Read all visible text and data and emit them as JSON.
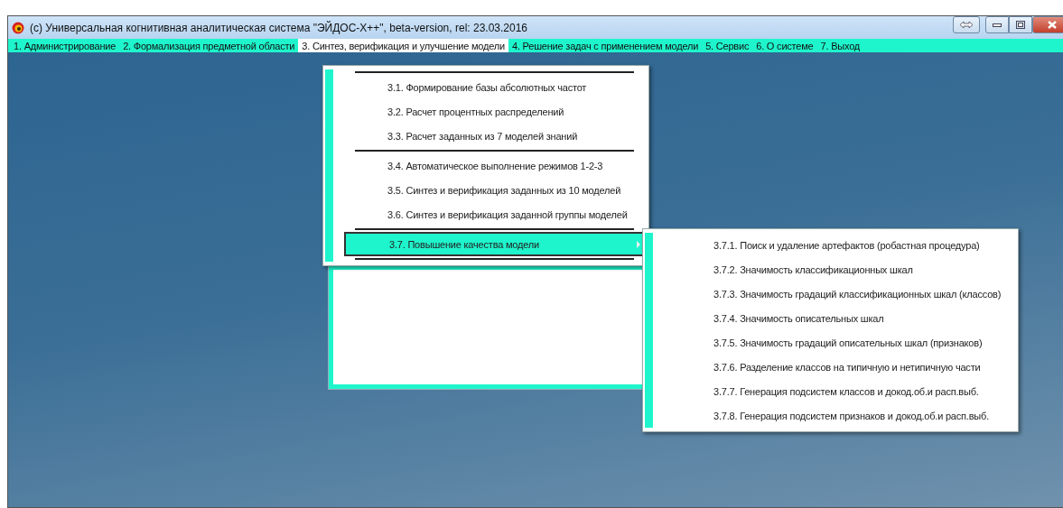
{
  "window": {
    "title": "(c) Универсальная когнитивная аналитическая система \"ЭЙДОС-X++\", beta-version, rel: 23.03.2016"
  },
  "menu_bar": [
    {
      "label": "1. Администрирование",
      "selected": false
    },
    {
      "label": "2. Формализация предметной области",
      "selected": false
    },
    {
      "label": "3. Синтез, верификация и улучшение модели",
      "selected": true
    },
    {
      "label": "4. Решение задач с применением модели",
      "selected": false
    },
    {
      "label": "5. Сервис",
      "selected": false
    },
    {
      "label": "6. О системе",
      "selected": false
    },
    {
      "label": "7. Выход",
      "selected": false
    }
  ],
  "dropdown": {
    "items": [
      {
        "kind": "separator"
      },
      {
        "kind": "item",
        "label": "3.1. Формирование базы абсолютных частот",
        "selected": false
      },
      {
        "kind": "item",
        "label": "3.2. Расчет процентных распределений",
        "selected": false
      },
      {
        "kind": "item",
        "label": "3.3. Расчет заданных из 7 моделей знаний",
        "selected": false
      },
      {
        "kind": "separator"
      },
      {
        "kind": "item",
        "label": "3.4. Автоматическое выполнение режимов 1-2-3",
        "selected": false
      },
      {
        "kind": "item",
        "label": "3.5. Синтез и верификация заданных из 10 моделей",
        "selected": false
      },
      {
        "kind": "item",
        "label": "3.6. Синтез и верификация заданной группы моделей",
        "selected": false
      },
      {
        "kind": "separator"
      },
      {
        "kind": "submenu",
        "label": "3.7. Повышение качества модели",
        "selected": true
      },
      {
        "kind": "separator"
      }
    ]
  },
  "submenu": {
    "items": [
      {
        "kind": "item",
        "label": "3.7.1. Поиск и удаление артефактов (робастная процедура)",
        "selected": false
      },
      {
        "kind": "item",
        "label": "3.7.2. Значимость классификационных шкал",
        "selected": false
      },
      {
        "kind": "item",
        "label": "3.7.3. Значимость градаций классификационных шкал (классов)",
        "selected": false
      },
      {
        "kind": "item",
        "label": "3.7.4. Значимость описательных шкал",
        "selected": false
      },
      {
        "kind": "item",
        "label": "3.7.5. Значимость градаций описательных шкал (признаков)",
        "selected": false
      },
      {
        "kind": "item",
        "label": "3.7.6. Разделение классов на типичную и нетипичную части",
        "selected": false
      },
      {
        "kind": "item",
        "label": "3.7.7. Генерация подсистем классов и докод.об.и расп.выб.",
        "selected": false
      },
      {
        "kind": "item",
        "label": "3.7.8. Генерация подсистем признаков и докод.об.и расп.выб.",
        "selected": false
      }
    ]
  }
}
